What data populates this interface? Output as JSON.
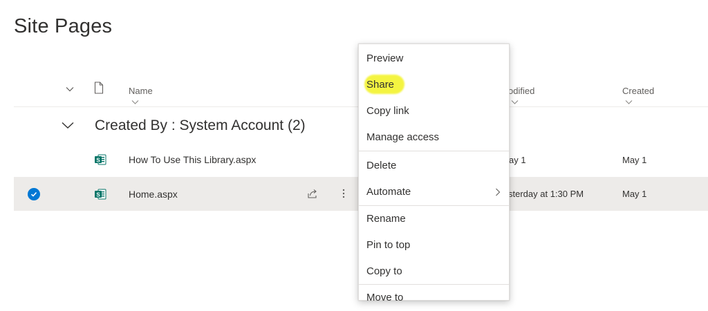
{
  "page": {
    "title": "Site Pages"
  },
  "columns": {
    "name": "Name",
    "modified": "odified",
    "created": "Created"
  },
  "group": {
    "label": "Created By : System Account (2)"
  },
  "rows": [
    {
      "name": "How To Use This Library.aspx",
      "modified": "ay 1",
      "created": "May 1",
      "selected": false
    },
    {
      "name": "Home.aspx",
      "modified": "sterday at 1:30 PM",
      "created": "May 1",
      "selected": true
    }
  ],
  "context_menu": {
    "items": [
      {
        "label": "Preview"
      },
      {
        "label": "Share",
        "highlighted": true
      },
      {
        "label": "Copy link"
      },
      {
        "label": "Manage access"
      },
      {
        "label": "Delete"
      },
      {
        "label": "Automate",
        "has_submenu": true
      },
      {
        "label": "Rename"
      },
      {
        "label": "Pin to top"
      },
      {
        "label": "Copy to"
      },
      {
        "label": "Move to"
      }
    ]
  },
  "colors": {
    "accent": "#0078d4",
    "selected_row": "#edebe9",
    "highlight": "#f4f441",
    "sharepoint_icon": "#077568"
  },
  "icons": {
    "header_toggle": "chevron-down-icon",
    "file_type_header": "document-icon",
    "group_toggle": "chevron-down-icon",
    "file_type": "sharepoint-page-icon",
    "share_row": "share-icon",
    "more_row": "more-vertical-icon",
    "selected": "checkmark-circle-icon",
    "submenu": "chevron-right-icon"
  }
}
